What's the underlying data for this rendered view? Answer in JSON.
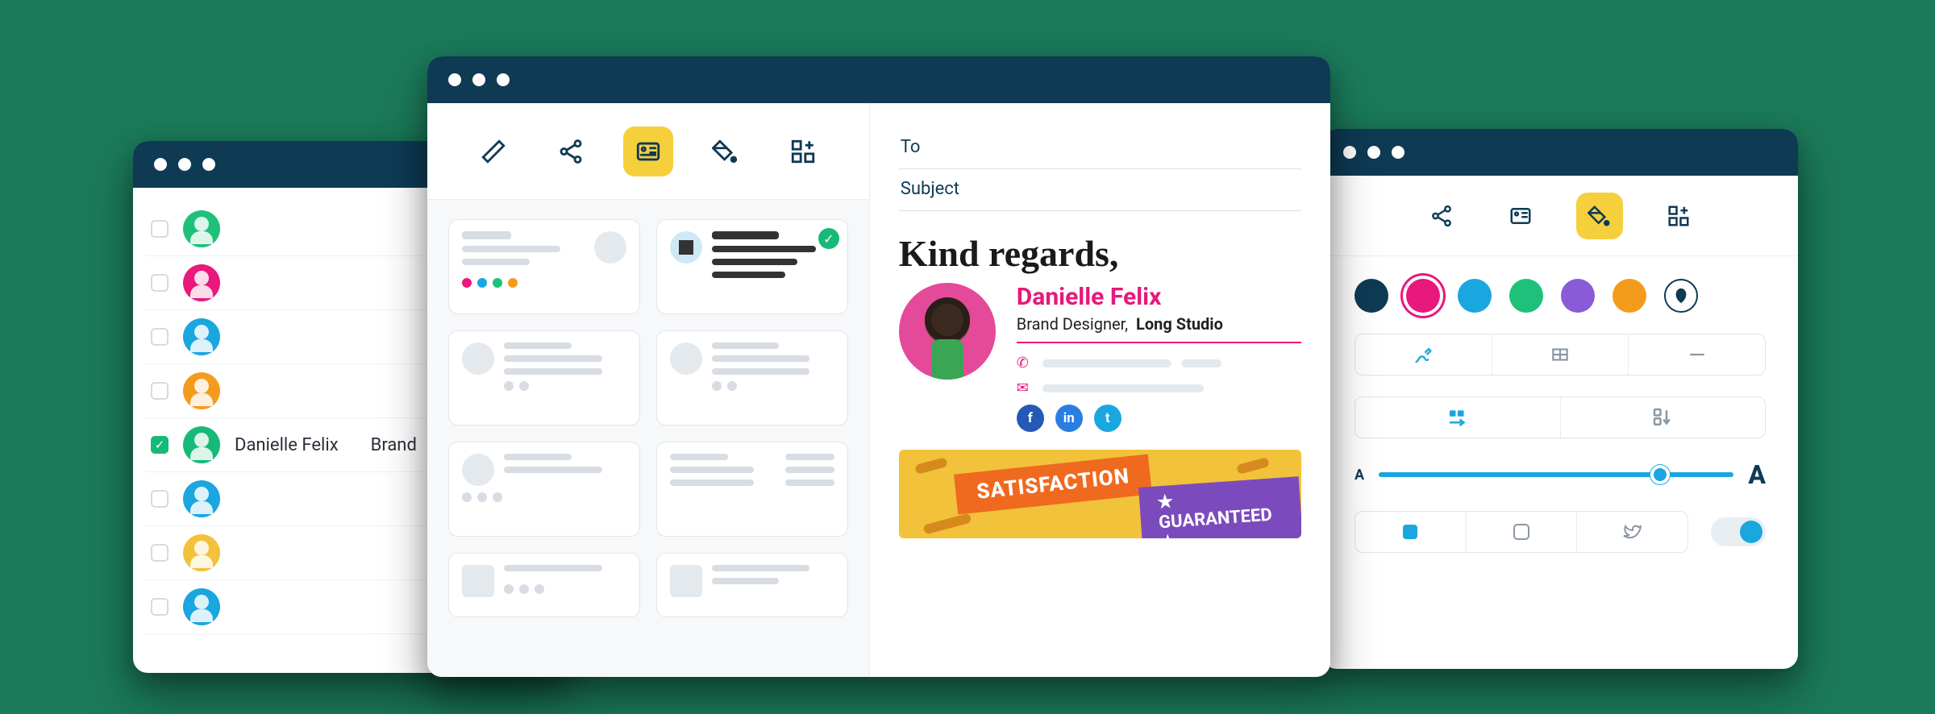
{
  "users": [
    {
      "color": "#1fc07a",
      "checked": false
    },
    {
      "color": "#e8187c",
      "checked": false
    },
    {
      "color": "#1aa6df",
      "checked": false
    },
    {
      "color": "#f59b1c",
      "checked": false
    },
    {
      "color": "#17b978",
      "checked": true,
      "name": "Danielle Felix",
      "role": "Brand"
    },
    {
      "color": "#1aa6df",
      "checked": false
    },
    {
      "color": "#f2c23a",
      "checked": false
    },
    {
      "color": "#1aa6df",
      "checked": false
    }
  ],
  "compose": {
    "to_label": "To",
    "subject_label": "Subject",
    "regards": "Kind regards,"
  },
  "signature": {
    "name": "Danielle Felix",
    "title": "Brand Designer,",
    "company": "Long Studio",
    "socials": [
      {
        "icon": "f",
        "bg": "#2459b5"
      },
      {
        "icon": "in",
        "bg": "#2a7de1"
      },
      {
        "icon": "t",
        "bg": "#1aa6df"
      }
    ]
  },
  "banner": {
    "text1": "SATISFACTION",
    "text2": "★ GUARANTEED ★"
  },
  "palette": {
    "swatches": [
      "#0e3a54",
      "#e8187c",
      "#1aa6df",
      "#1fc07a",
      "#8a5bd8",
      "#f59b1c"
    ]
  },
  "font_size": {
    "small": "A",
    "large": "A"
  }
}
